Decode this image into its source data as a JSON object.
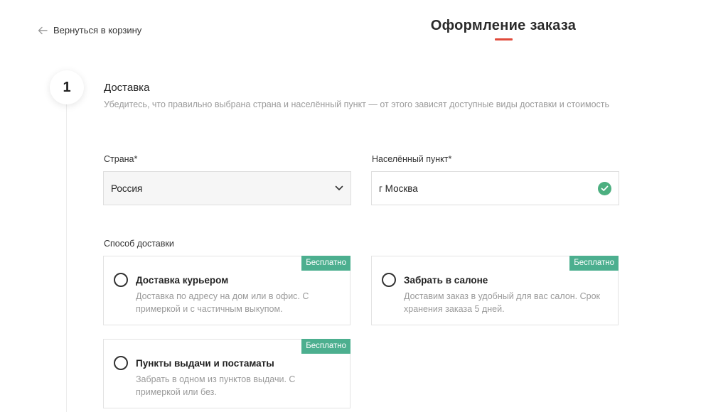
{
  "header": {
    "back_label": "Вернуться в корзину",
    "title": "Оформление заказа"
  },
  "step": {
    "number": "1",
    "title": "Доставка",
    "description": "Убедитесь, что правильно выбрана страна и населённый пункт — от этого зависят доступные виды доставки и стоимость"
  },
  "form": {
    "country_label": "Страна*",
    "country_value": "Россия",
    "city_label": "Населённый пункт*",
    "city_value": "г Москва"
  },
  "delivery": {
    "label": "Способ доставки",
    "options": [
      {
        "title": "Доставка курьером",
        "description": "Доставка по адресу на дом или в офис. С примеркой и с частичным выкупом.",
        "badge": "Бесплатно"
      },
      {
        "title": "Забрать в салоне",
        "description": "Доставим заказ в удобный для вас салон. Срок хранения заказа 5 дней.",
        "badge": "Бесплатно"
      },
      {
        "title": "Пункты выдачи и постаматы",
        "description": "Забрать в одном из пунктов выдачи. С примеркой или без.",
        "badge": "Бесплатно"
      }
    ]
  },
  "colors": {
    "accent_underline": "#e04a3b",
    "badge_green": "#4caf8f",
    "check_green": "#4caf80"
  },
  "icons": {
    "back": "arrow-left-icon",
    "dropdown": "chevron-down-icon",
    "valid": "check-circle-icon"
  }
}
